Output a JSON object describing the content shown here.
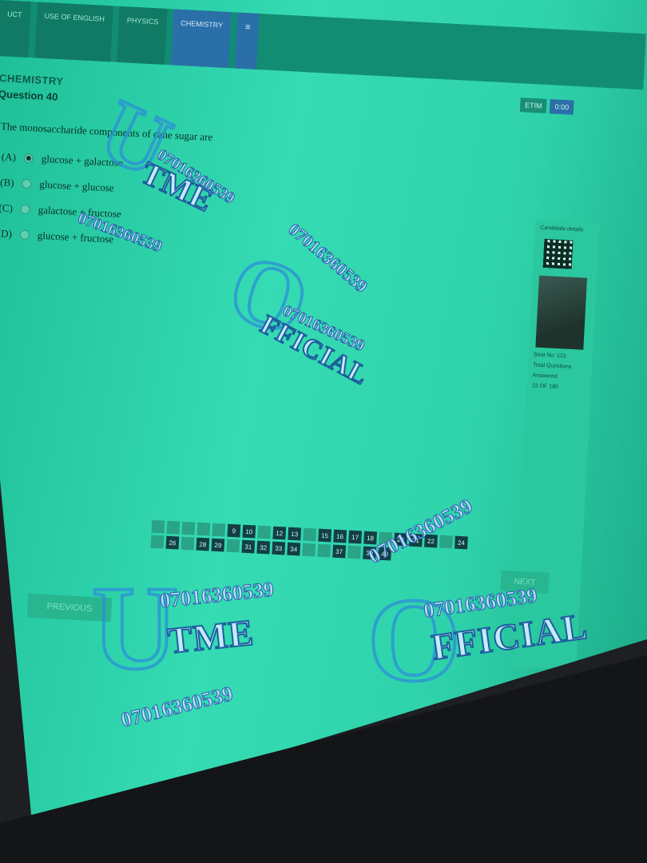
{
  "tabs": [
    {
      "label": "UCT"
    },
    {
      "label": "USE OF ENGLISH"
    },
    {
      "label": "PHYSICS"
    },
    {
      "label": "CHEMISTRY",
      "active": true
    },
    {
      "label": "≡"
    }
  ],
  "header": {
    "subject": "CHEMISTRY",
    "question_number": "Question 40",
    "timer_label": "ETIM",
    "timer_value": "0:00"
  },
  "question": {
    "text": "The monosaccharide components of cane sugar are",
    "options": [
      {
        "letter": "(A)",
        "text": "glucose + galactose",
        "selected": true
      },
      {
        "letter": "(B)",
        "text": "glucose + glucose",
        "selected": false
      },
      {
        "letter": "(C)",
        "text": "galactose + fructose",
        "selected": false
      },
      {
        "letter": "(D)",
        "text": "glucose + fructose",
        "selected": false
      }
    ]
  },
  "sidebar": {
    "title": "Candidate details",
    "seat": "Seat No: 123",
    "total": "Total Questions",
    "answered": "Answered",
    "of": "22 OF 180"
  },
  "grid": {
    "row1": [
      "",
      "",
      "",
      "",
      "",
      "9",
      "10",
      "",
      "12",
      "13",
      "",
      "15",
      "16",
      "17",
      "18",
      "",
      "20",
      "21",
      "22",
      "",
      "24"
    ],
    "row2": [
      "",
      "26",
      "",
      "28",
      "29",
      "",
      "31",
      "32",
      "33",
      "34",
      "",
      "",
      "37",
      "",
      "39",
      "40"
    ]
  },
  "buttons": {
    "previous": "PREVIOUS",
    "next": "NEXT"
  },
  "watermark": {
    "phone": "07016360539",
    "word_utme": "TME",
    "letter_u": "U",
    "letter_o": "O",
    "word_official": "FFICIAL"
  },
  "colors": {
    "screen": "#2fd3ab",
    "tab_active": "#2a6fa8",
    "watermark": "#2c8fd8"
  }
}
